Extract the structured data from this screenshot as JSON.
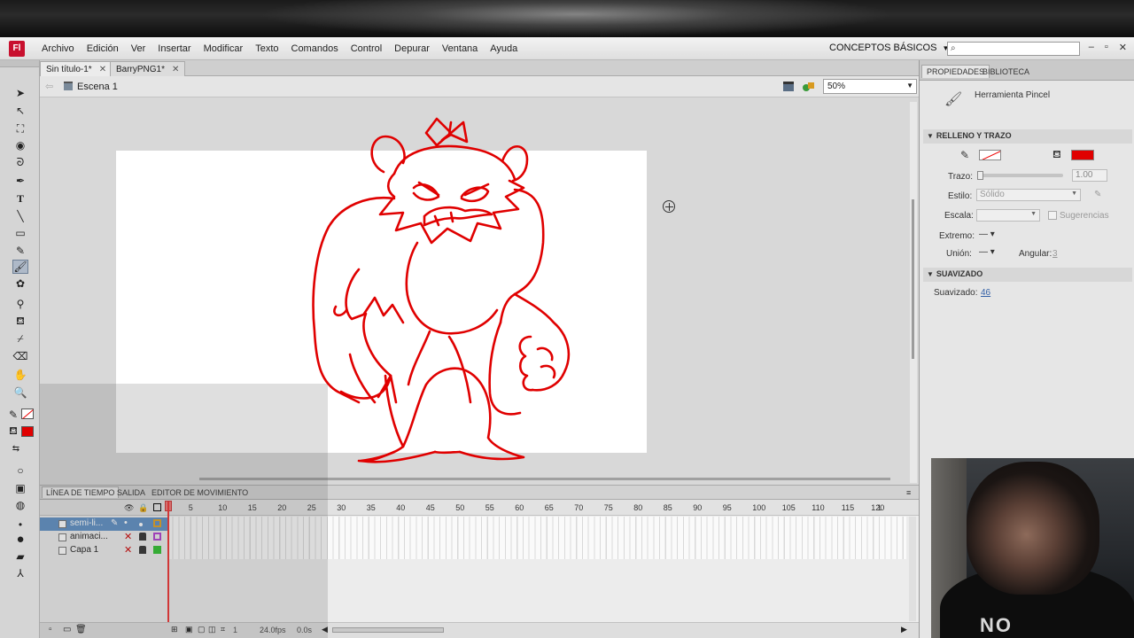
{
  "app": {
    "icon_label": "Fl"
  },
  "menu": [
    "Archivo",
    "Edición",
    "Ver",
    "Insertar",
    "Modificar",
    "Texto",
    "Comandos",
    "Control",
    "Depurar",
    "Ventana",
    "Ayuda"
  ],
  "workspace": {
    "label": "CONCEPTOS BÁSICOS"
  },
  "help_search": {
    "value": ""
  },
  "doc_tabs": [
    {
      "label": "Sin título-1*",
      "active": true
    },
    {
      "label": "BarryPNG1*",
      "active": false
    }
  ],
  "edit_bar": {
    "scene": "Escena 1",
    "zoom": "50%"
  },
  "tools": [
    "selection",
    "subselection",
    "free-transform",
    "3d-rotation",
    "lasso",
    "pen",
    "text",
    "line",
    "rectangle",
    "pencil",
    "brush",
    "deco",
    "bone",
    "paint-bucket",
    "eyedropper",
    "eraser",
    "hand",
    "zoom"
  ],
  "timeline": {
    "tabs": [
      "LÍNEA DE TIEMPO",
      "SALIDA",
      "EDITOR DE MOVIMIENTO"
    ],
    "frame_numbers": [
      "1",
      "5",
      "10",
      "15",
      "20",
      "25",
      "30",
      "35",
      "40",
      "45",
      "50",
      "55",
      "60",
      "65",
      "70",
      "75",
      "80",
      "85",
      "90",
      "95",
      "100",
      "105",
      "110",
      "115",
      "120",
      "1"
    ],
    "layers": [
      {
        "name": "semi-li...",
        "selected": true,
        "outline_color": "#e0a020"
      },
      {
        "name": "animaci...",
        "selected": false,
        "outline_color": "#b040d0"
      },
      {
        "name": "Capa 1",
        "selected": false,
        "outline_color": "#30c030"
      }
    ],
    "fps": "24.0fps",
    "time": "0.0s",
    "current_frame": "1"
  },
  "properties": {
    "tabs": [
      "PROPIEDADES",
      "BIBLIOTECA"
    ],
    "tool_name": "Herramienta Pincel",
    "section_fill_stroke": "RELLENO Y TRAZO",
    "stroke_label": "Trazo:",
    "stroke_value": "1.00",
    "style_label": "Estilo:",
    "style_value": "Sólido",
    "scale_label": "Escala:",
    "hints_label": "Sugerencias",
    "cap_label": "Extremo:",
    "join_label": "Unión:",
    "miter_label": "Angular:",
    "miter_value": "3",
    "section_smoothing": "SUAVIZADO",
    "smoothing_label": "Suavizado:",
    "smoothing_value": "46",
    "fill_color": "#e00000",
    "stroke_color": "#e00000"
  },
  "webcam": {
    "shirt_text": "NO"
  }
}
